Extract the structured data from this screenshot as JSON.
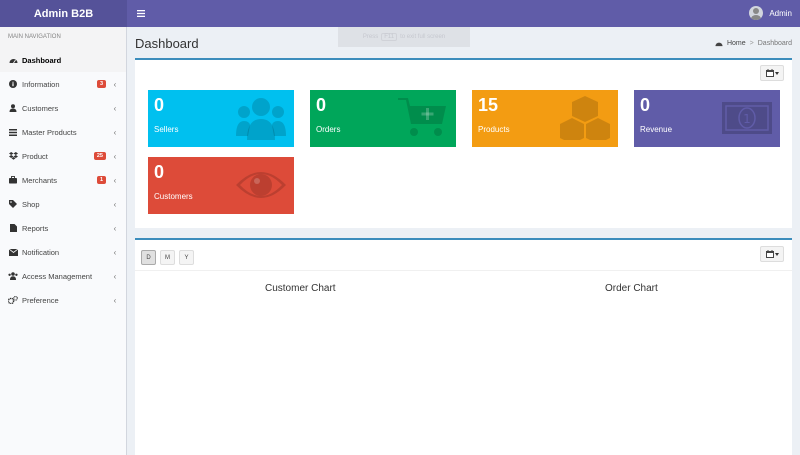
{
  "header": {
    "brand": "Admin B2B",
    "menu_icon": "hamburger-icon",
    "user_name": "Admin"
  },
  "fullscreen_hint": {
    "prefix": "Press",
    "key": "F11",
    "suffix": "to exit full screen"
  },
  "sidebar": {
    "section_title": "MAIN NAVIGATION",
    "items": [
      {
        "label": "Dashboard",
        "icon": "dashboard-icon",
        "active": true
      },
      {
        "label": "Information",
        "icon": "info-icon",
        "badge": "3"
      },
      {
        "label": "Customers",
        "icon": "user-icon"
      },
      {
        "label": "Master Products",
        "icon": "list-icon"
      },
      {
        "label": "Product",
        "icon": "dropbox-icon",
        "badge": "25"
      },
      {
        "label": "Merchants",
        "icon": "briefcase-icon",
        "badge": "1"
      },
      {
        "label": "Shop",
        "icon": "tag-icon"
      },
      {
        "label": "Reports",
        "icon": "file-icon"
      },
      {
        "label": "Notification",
        "icon": "envelope-icon"
      },
      {
        "label": "Access Management",
        "icon": "users-icon"
      },
      {
        "label": "Preference",
        "icon": "gears-icon"
      }
    ]
  },
  "page": {
    "title": "Dashboard",
    "breadcrumb": [
      "Home",
      "Dashboard"
    ]
  },
  "stats": [
    {
      "value": "0",
      "label": "Sellers",
      "color": "#00c0ef",
      "icon": "users-icon"
    },
    {
      "value": "0",
      "label": "Orders",
      "color": "#00a65a",
      "icon": "cart-plus-icon"
    },
    {
      "value": "15",
      "label": "Products",
      "color": "#f39c12",
      "icon": "cubes-icon"
    },
    {
      "value": "0",
      "label": "Revenue",
      "color": "#605ca8",
      "icon": "money-icon"
    },
    {
      "value": "0",
      "label": "Customers",
      "color": "#dd4b39",
      "icon": "eye-icon"
    }
  ],
  "period_buttons": [
    "D",
    "M",
    "Y"
  ],
  "charts": {
    "customer_title": "Customer Chart",
    "order_title": "Order Chart"
  }
}
